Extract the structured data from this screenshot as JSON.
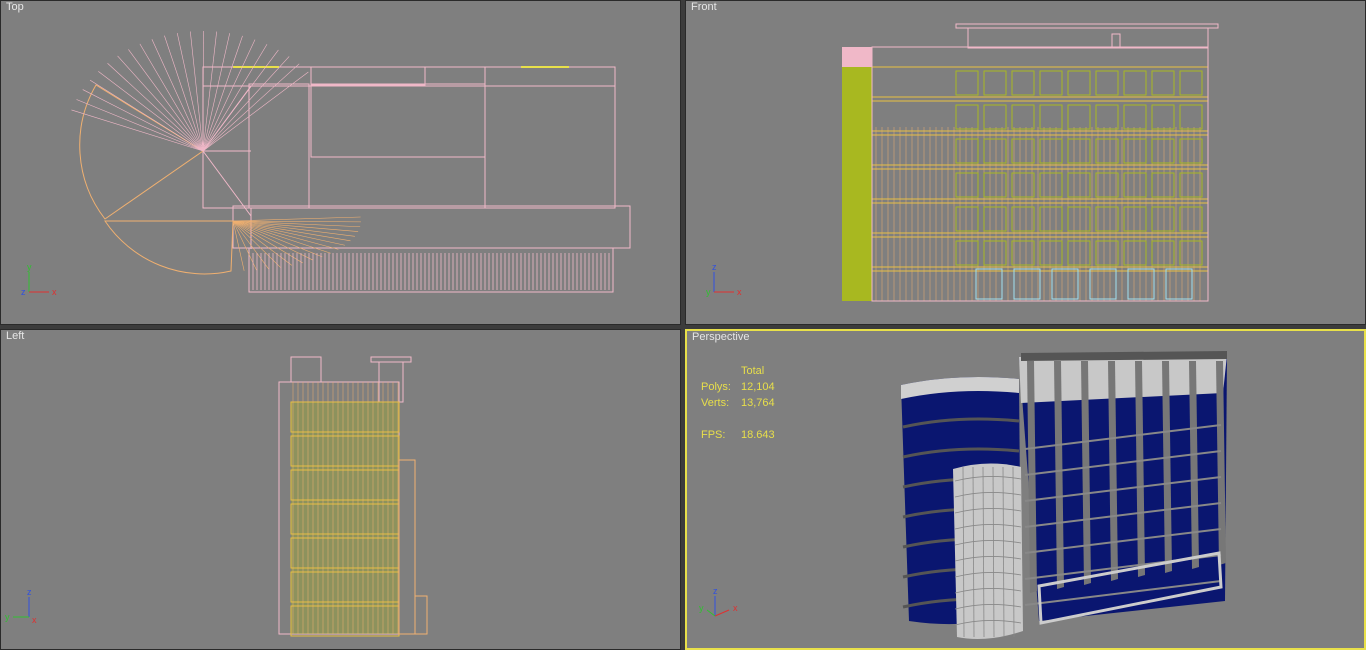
{
  "viewports": {
    "top": {
      "label": "Top"
    },
    "front": {
      "label": "Front"
    },
    "left": {
      "label": "Left"
    },
    "perspective": {
      "label": "Perspective"
    }
  },
  "stats": {
    "header": "Total",
    "polys_label": "Polys:",
    "polys_value": "12,104",
    "verts_label": "Verts:",
    "verts_value": "13,764",
    "fps_label": "FPS:",
    "fps_value": "18.643"
  },
  "axes": {
    "top": {
      "v": "y",
      "h": "x",
      "c": "z"
    },
    "front": {
      "v": "z",
      "h": "x",
      "c": "y"
    },
    "left": {
      "v": "z",
      "h": "y",
      "c": "x"
    },
    "perspective": {
      "v": "z",
      "h": "x",
      "c": "y"
    }
  },
  "colors": {
    "background": "#7f7f7f",
    "active_border": "#e8e04a",
    "wire_pink": "#f0b8c8",
    "wire_orange": "#f0b070",
    "wire_olive": "#a8b820",
    "glass_blue": "#0a1670",
    "stats_text": "#e8df4a",
    "axis_x": "#e03030",
    "axis_y": "#30c030",
    "axis_z": "#3050e0"
  }
}
